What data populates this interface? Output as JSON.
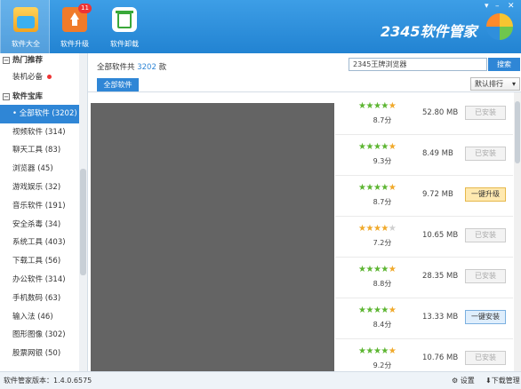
{
  "toolbar": {
    "items": [
      {
        "label": "软件大全",
        "icon": "software-store-icon",
        "active": true
      },
      {
        "label": "软件升级",
        "icon": "upgrade-icon",
        "badge": "11"
      },
      {
        "label": "软件卸载",
        "icon": "uninstall-icon"
      }
    ],
    "brand": "2345软件管家"
  },
  "sidebar": {
    "section_hot": "热门推荐",
    "hot_items": [
      {
        "label": "装机必备"
      }
    ],
    "section_library": "软件宝库",
    "items": [
      {
        "label": "全部软件 (3202)",
        "selected": true
      },
      {
        "label": "视频软件 (314)"
      },
      {
        "label": "聊天工具 (83)"
      },
      {
        "label": "浏览器 (45)"
      },
      {
        "label": "游戏娱乐 (32)"
      },
      {
        "label": "音乐软件 (191)"
      },
      {
        "label": "安全杀毒 (34)"
      },
      {
        "label": "系统工具 (403)"
      },
      {
        "label": "下载工具 (56)"
      },
      {
        "label": "办公软件 (314)"
      },
      {
        "label": "手机数码 (63)"
      },
      {
        "label": "输入法 (46)"
      },
      {
        "label": "图形图像 (302)"
      },
      {
        "label": "股票网银 (50)"
      }
    ]
  },
  "header": {
    "count_prefix": "全部软件共",
    "count": "3202",
    "count_suffix": "款",
    "search_value": "2345王牌浏览器",
    "search_button": "搜索",
    "tab": "全部软件",
    "sort": "默认排行"
  },
  "list": {
    "rows": [
      {
        "rating": 4.5,
        "score": "8.7分",
        "size": "52.80 MB",
        "action": "已安装",
        "state": "installed"
      },
      {
        "rating": 4.5,
        "score": "9.3分",
        "size": "8.49 MB",
        "action": "已安装",
        "state": "installed"
      },
      {
        "rating": 4.5,
        "score": "8.7分",
        "size": "9.72 MB",
        "action": "一键升级",
        "state": "upgrade"
      },
      {
        "rating": 3.5,
        "score": "7.2分",
        "size": "10.65 MB",
        "action": "已安装",
        "state": "installed"
      },
      {
        "rating": 4.5,
        "score": "8.8分",
        "size": "28.35 MB",
        "action": "已安装",
        "state": "installed"
      },
      {
        "rating": 4.5,
        "score": "8.4分",
        "size": "13.33 MB",
        "action": "一键安装",
        "state": "install"
      },
      {
        "rating": 4.5,
        "score": "9.2分",
        "size": "10.76 MB",
        "action": "已安装",
        "state": "installed"
      }
    ]
  },
  "status": {
    "version": "软件管家版本：1.4.0.6575",
    "settings": "设置",
    "downloads": "下载管理"
  },
  "colors": {
    "accent": "#2f86d6",
    "star": "#5cb531"
  }
}
